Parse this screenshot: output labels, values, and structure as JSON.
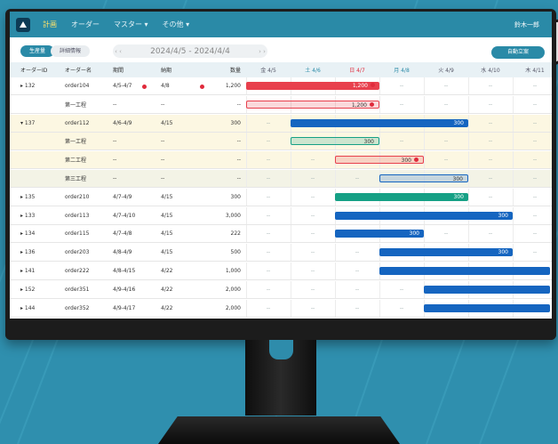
{
  "header": {
    "nav": [
      "計画",
      "オーダー",
      "マスター ▾",
      "その他 ▾"
    ],
    "user": "鈴木一郎"
  },
  "toolbar": {
    "view_tabs": [
      "生産量",
      "詳細情報"
    ],
    "date_range": "2024/4/5 - 2024/4/4",
    "nav_prev": "‹ ‹",
    "nav_next": "› ›",
    "auto_button": "自動立案"
  },
  "columns": {
    "id": "オーダーID",
    "name": "オーダー名",
    "period": "期間",
    "due": "納期",
    "qty": "数量",
    "days": [
      "金 4/5",
      "土 4/6",
      "日 4/7",
      "月 4/8",
      "火 4/9",
      "水 4/10",
      "木 4/11"
    ]
  },
  "rows": [
    {
      "id": "▸ 132",
      "name": "order104",
      "period": "4/5-4/7",
      "due": "4/8",
      "qty": "1,200",
      "bar_label": "1,200"
    },
    {
      "id": "",
      "name": "第一工程",
      "period": "--",
      "due": "--",
      "qty": "--",
      "bar_label": "1,200"
    },
    {
      "id": "▾ 137",
      "name": "order112",
      "period": "4/6-4/9",
      "due": "4/15",
      "qty": "300",
      "bar_label": "300"
    },
    {
      "id": "",
      "name": "第一工程",
      "period": "--",
      "due": "--",
      "qty": "--",
      "bar_label": "300"
    },
    {
      "id": "",
      "name": "第二工程",
      "period": "--",
      "due": "--",
      "qty": "--",
      "bar_label": "300"
    },
    {
      "id": "",
      "name": "第三工程",
      "period": "--",
      "due": "--",
      "qty": "--",
      "bar_label": "300"
    },
    {
      "id": "▸ 135",
      "name": "order210",
      "period": "4/7-4/9",
      "due": "4/15",
      "qty": "300",
      "bar_label": "300"
    },
    {
      "id": "▸ 133",
      "name": "order113",
      "period": "4/7-4/10",
      "due": "4/15",
      "qty": "3,000",
      "bar_label": "300"
    },
    {
      "id": "▸ 134",
      "name": "order115",
      "period": "4/7-4/8",
      "due": "4/15",
      "qty": "222",
      "bar_label": "300"
    },
    {
      "id": "▸ 136",
      "name": "order203",
      "period": "4/8-4/9",
      "due": "4/15",
      "qty": "500",
      "bar_label": "300"
    },
    {
      "id": "▸ 141",
      "name": "order222",
      "period": "4/8-4/15",
      "due": "4/22",
      "qty": "1,000",
      "bar_label": ""
    },
    {
      "id": "▸ 152",
      "name": "order351",
      "period": "4/9-4/16",
      "due": "4/22",
      "qty": "2,000",
      "bar_label": ""
    },
    {
      "id": "▸ 144",
      "name": "order352",
      "period": "4/9-4/17",
      "due": "4/22",
      "qty": "2,000",
      "bar_label": ""
    }
  ],
  "empty_cell": "--",
  "colors": {
    "brand": "#2a8aa7",
    "red": "#e8404d",
    "blue": "#1565c0",
    "teal": "#16a085"
  }
}
